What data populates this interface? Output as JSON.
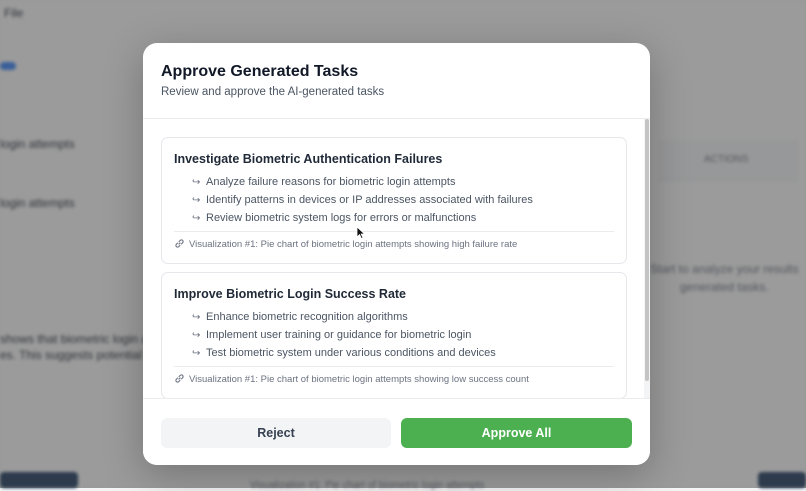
{
  "background": {
    "menu_label": "File",
    "row1_text": "login attempts",
    "row2_text": "login attempts",
    "column_header": "ACTIONS",
    "side_text_1": "Start to analyze your results",
    "side_text_2": "generated tasks.",
    "para_line_1": "shows that biometric login at",
    "para_line_2": "es. This suggests potential",
    "footer_text": "Visualization #1: Pie chart of biometric login attempts"
  },
  "modal": {
    "title": "Approve Generated Tasks",
    "subtitle": "Review and approve the AI-generated tasks",
    "tasks": [
      {
        "title": "Investigate Biometric Authentication Failures",
        "subtasks": [
          "Analyze failure reasons for biometric login attempts",
          "Identify patterns in devices or IP addresses associated with failures",
          "Review biometric system logs for errors or malfunctions"
        ],
        "visualization": "Visualization #1: Pie chart of biometric login attempts showing high failure rate"
      },
      {
        "title": "Improve Biometric Login Success Rate",
        "subtasks": [
          "Enhance biometric recognition algorithms",
          "Implement user training or guidance for biometric login",
          "Test biometric system under various conditions and devices"
        ],
        "visualization": "Visualization #1: Pie chart of biometric login attempts showing low success count"
      }
    ],
    "reject_label": "Reject",
    "approve_label": "Approve All"
  },
  "icons": {
    "subtask_marker": "return-arrow-icon",
    "visualization": "link-icon"
  },
  "colors": {
    "approve": "#4caf50",
    "reject_bg": "#f3f4f6",
    "overlay": "rgba(60,60,60,0.5)"
  }
}
